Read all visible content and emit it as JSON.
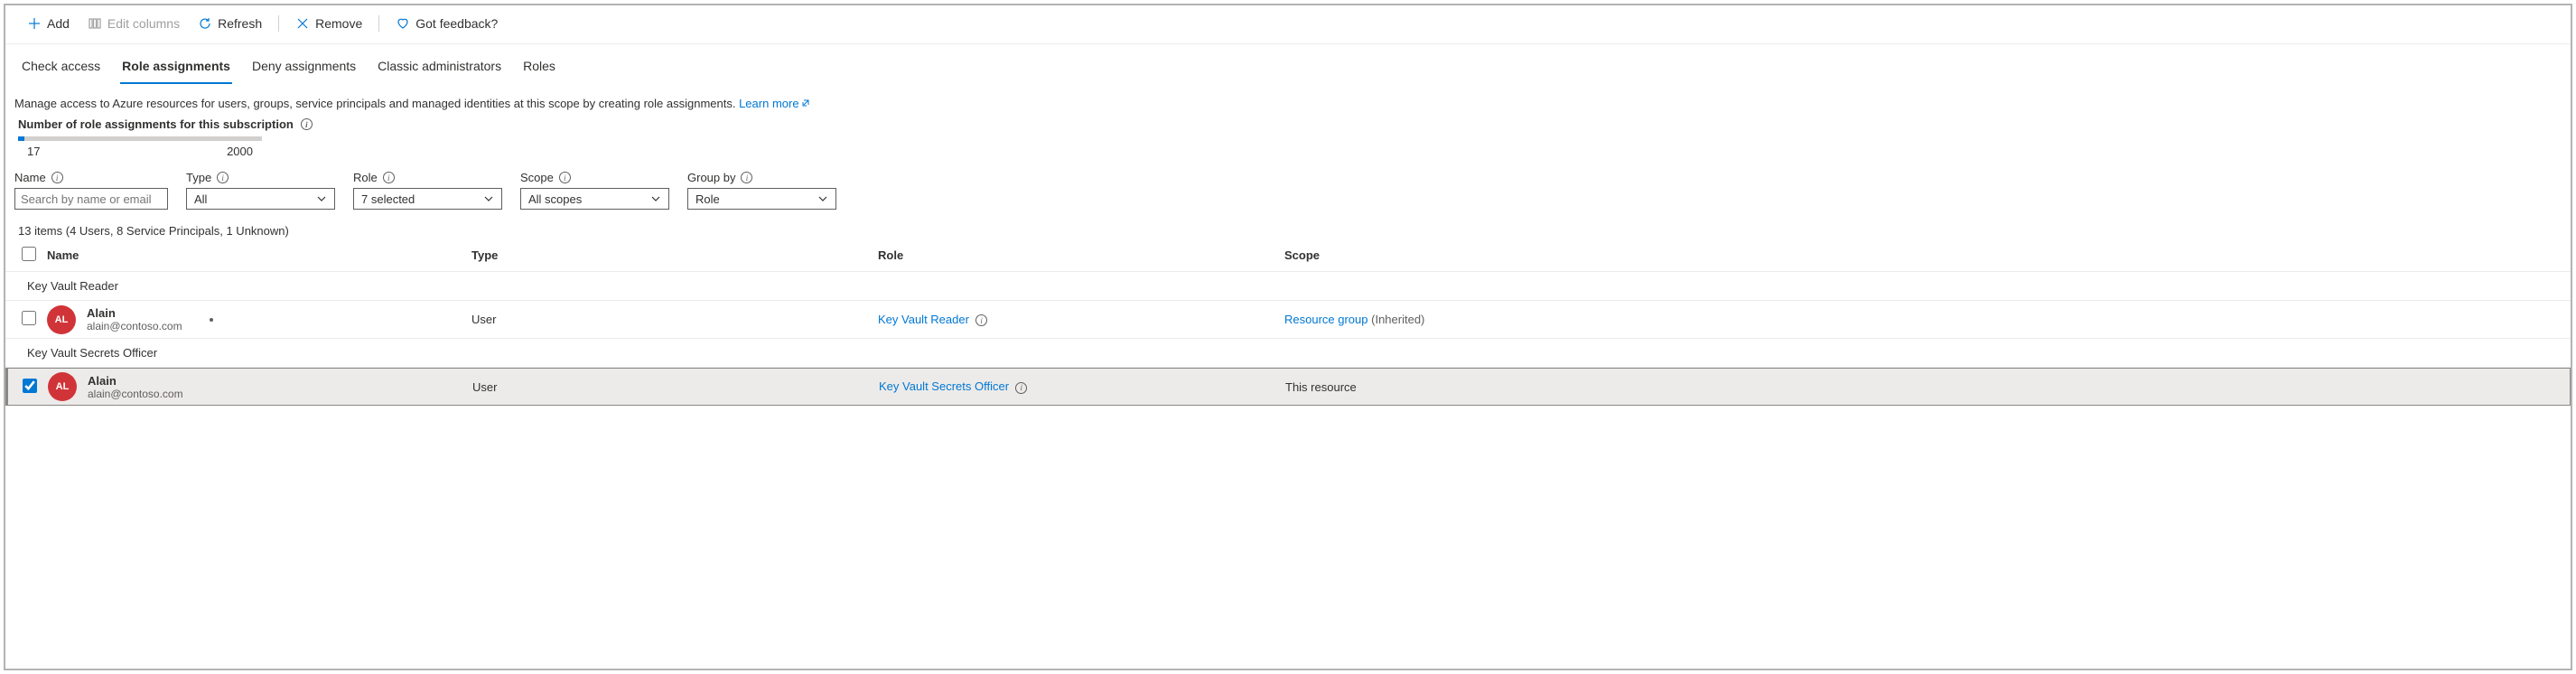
{
  "toolbar": {
    "add": "Add",
    "edit_columns": "Edit columns",
    "refresh": "Refresh",
    "remove": "Remove",
    "feedback": "Got feedback?"
  },
  "tabs": {
    "check_access": "Check access",
    "role_assignments": "Role assignments",
    "deny_assignments": "Deny assignments",
    "classic_administrators": "Classic administrators",
    "roles": "Roles"
  },
  "description": {
    "text": "Manage access to Azure resources for users, groups, service principals and managed identities at this scope by creating role assignments. ",
    "learn_more": "Learn more"
  },
  "quota": {
    "label": "Number of role assignments for this subscription",
    "current": "17",
    "max": "2000"
  },
  "filters": {
    "name_label": "Name",
    "name_placeholder": "Search by name or email",
    "type_label": "Type",
    "type_value": "All",
    "role_label": "Role",
    "role_value": "7 selected",
    "scope_label": "Scope",
    "scope_value": "All scopes",
    "groupby_label": "Group by",
    "groupby_value": "Role"
  },
  "count_text": "13 items (4 Users, 8 Service Principals, 1 Unknown)",
  "headers": {
    "name": "Name",
    "type": "Type",
    "role": "Role",
    "scope": "Scope"
  },
  "groups": {
    "g1": "Key Vault Reader",
    "g2": "Key Vault Secrets Officer"
  },
  "rows": {
    "r1": {
      "initials": "AL",
      "name": "Alain",
      "email": "alain@contoso.com",
      "type": "User",
      "role": "Key Vault Reader",
      "scope_link": "Resource group",
      "scope_suffix": "(Inherited)"
    },
    "r2": {
      "initials": "AL",
      "name": "Alain",
      "email": "alain@contoso.com",
      "type": "User",
      "role": "Key Vault Secrets Officer",
      "scope": "This resource"
    }
  }
}
